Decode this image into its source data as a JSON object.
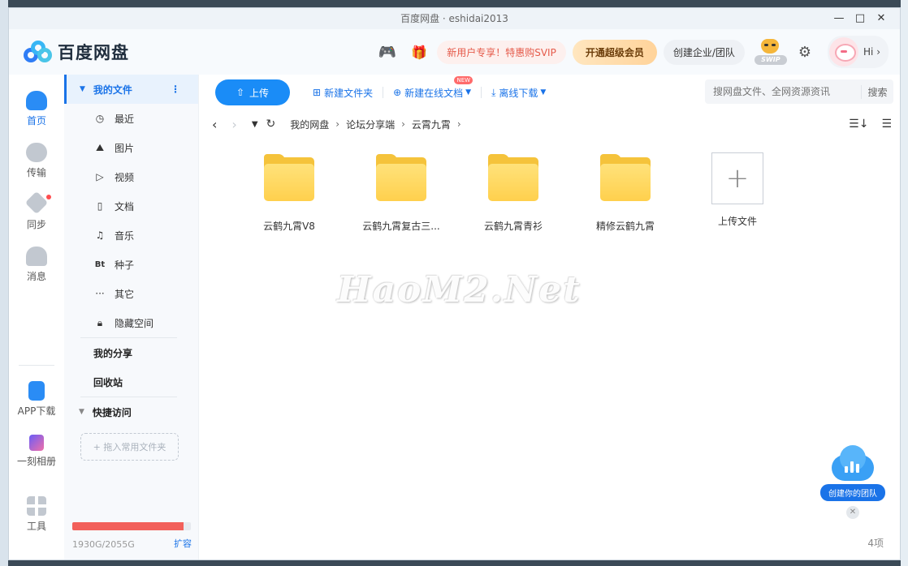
{
  "window": {
    "title": "百度网盘 · eshidai2013",
    "controls": [
      "—",
      "□",
      "✕"
    ]
  },
  "brand": {
    "name": "百度网盘"
  },
  "header": {
    "new_user_promo": "新用户专享！特惠购SVIP",
    "vip_button": "开通超级会员",
    "enterprise_button": "创建企业/团队",
    "svip_badge": "SWIP",
    "greeting": "Hi ›"
  },
  "rail": {
    "items": [
      {
        "label": "首页",
        "icon": "cloud-icon",
        "active": true
      },
      {
        "label": "传输",
        "icon": "transfer-icon"
      },
      {
        "label": "同步",
        "icon": "sync-icon"
      },
      {
        "label": "消息",
        "icon": "message-icon"
      },
      {
        "label": "APP下载",
        "icon": "phone-icon"
      },
      {
        "label": "一刻相册",
        "icon": "album-icon"
      },
      {
        "label": "工具",
        "icon": "tools-icon"
      }
    ]
  },
  "sidebar": {
    "my_files": "我的文件",
    "items": [
      {
        "label": "最近",
        "icon": "clock-icon"
      },
      {
        "label": "图片",
        "icon": "image-icon"
      },
      {
        "label": "视频",
        "icon": "video-icon"
      },
      {
        "label": "文档",
        "icon": "document-icon"
      },
      {
        "label": "音乐",
        "icon": "music-icon"
      },
      {
        "label": "种子",
        "icon": "torrent-icon"
      },
      {
        "label": "其它",
        "icon": "more-icon"
      },
      {
        "label": "隐藏空间",
        "icon": "lock-icon"
      }
    ],
    "my_share": "我的分享",
    "recycle_bin": "回收站",
    "quick_access": "快捷访问",
    "drop_hint": "+ 拖入常用文件夹",
    "quota_text": "1930G/2055G",
    "quota_used_fraction": 0.939,
    "expand": "扩容"
  },
  "toolbar": {
    "upload": "上传",
    "new_folder": "新建文件夹",
    "new_online_doc": "新建在线文档",
    "new_badge": "NEW",
    "offline_download": "离线下载",
    "search_placeholder": "搜网盘文件、全网资源资讯",
    "search_button": "搜索"
  },
  "breadcrumb": [
    "我的网盘",
    "论坛分享端",
    "云霄九霄"
  ],
  "files": [
    {
      "name": "云鹤九霄V8"
    },
    {
      "name": "云鹤九霄复古三..."
    },
    {
      "name": "云鹤九霄青衫"
    },
    {
      "name": "精修云鹤九霄"
    }
  ],
  "upload_tile": "上传文件",
  "watermark": "HaoM2.Net",
  "item_count": "4项",
  "promo": "创建你的团队"
}
